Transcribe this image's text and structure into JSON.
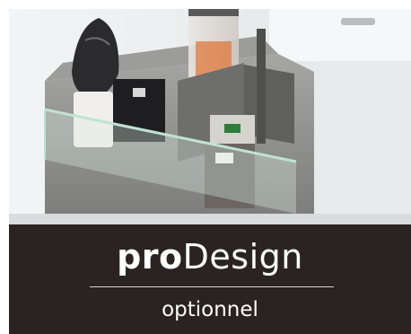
{
  "banner": {
    "title_bold": "pro",
    "title_light": "Design",
    "subtitle": "optionnel"
  },
  "photo": {
    "subject": "pull-out drawer with glass sides and dividers holding packaged food items"
  },
  "colors": {
    "banner_background": "#2a2223",
    "banner_text": "#ffffff",
    "cabinet": "#eceef0",
    "drawer_interior": "#8f8f8d",
    "glass_edge": "#bfe3d2"
  }
}
